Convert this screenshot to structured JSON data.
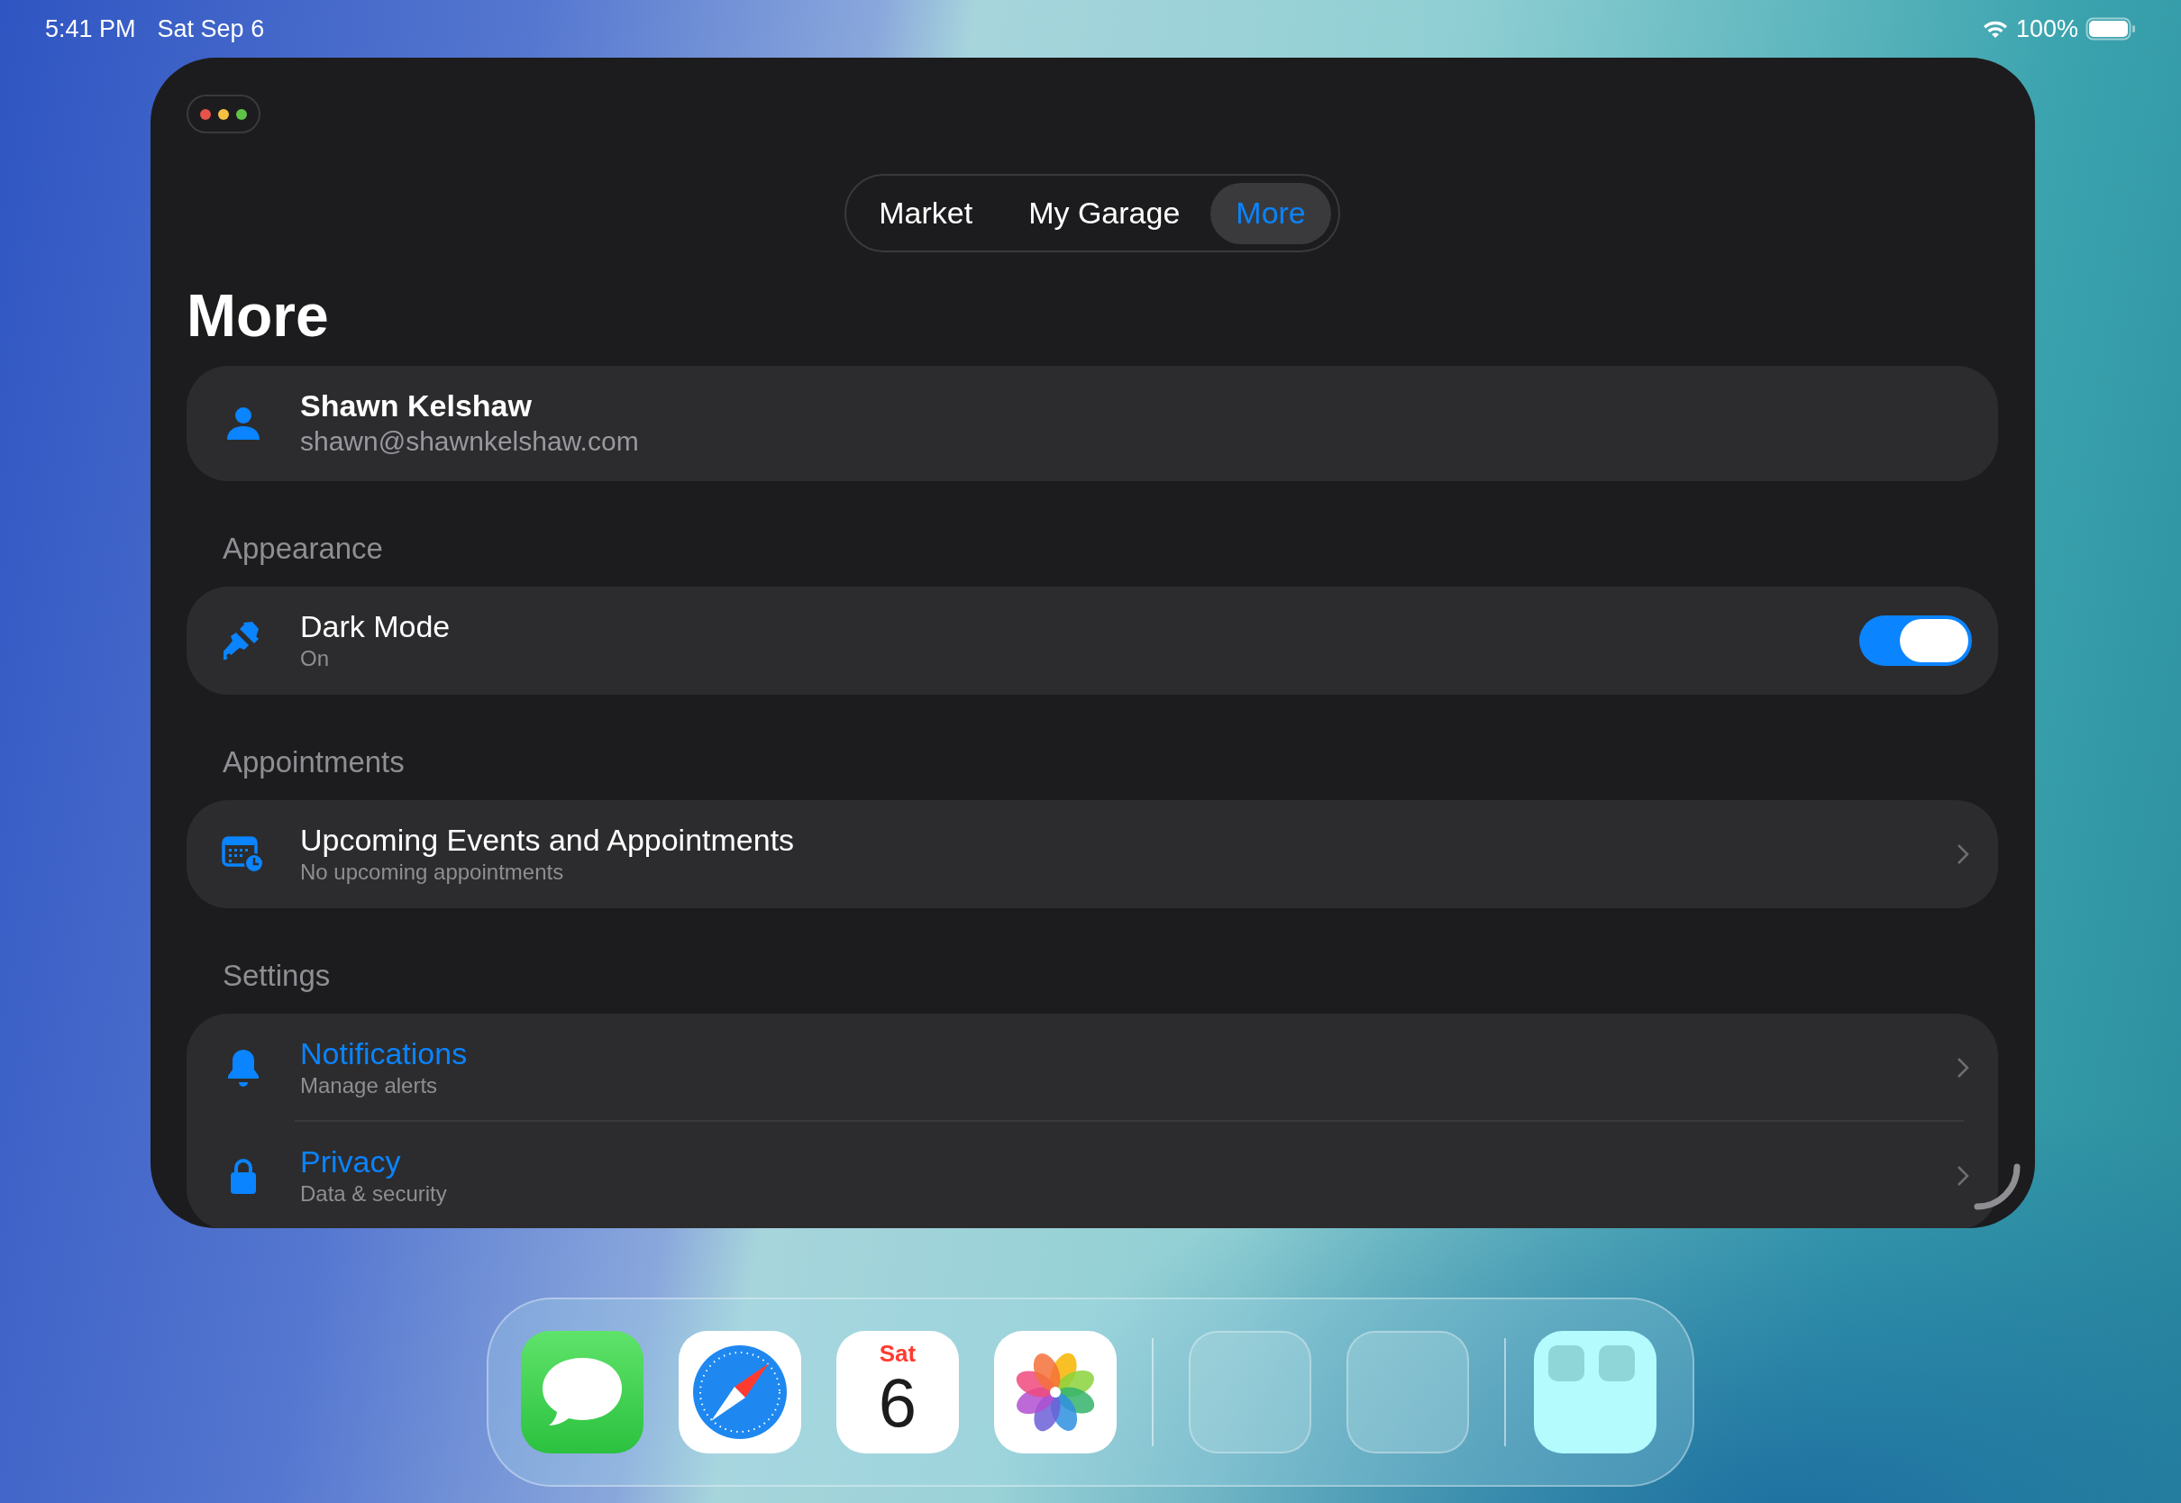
{
  "status_bar": {
    "time": "5:41 PM",
    "date": "Sat Sep 6",
    "battery": "100%"
  },
  "tabs": [
    {
      "label": "Market",
      "selected": false
    },
    {
      "label": "My Garage",
      "selected": false
    },
    {
      "label": "More",
      "selected": true
    }
  ],
  "title": "More",
  "profile": {
    "name": "Shawn Kelshaw",
    "email": "shawn@shawnkelshaw.com"
  },
  "sections": [
    {
      "header": "Appearance",
      "rows": [
        {
          "kind": "toggle",
          "title": "Dark Mode",
          "subtitle": "On",
          "color": "#ffffff",
          "on": true
        }
      ]
    },
    {
      "header": "Appointments",
      "rows": [
        {
          "kind": "link",
          "title": "Upcoming Events and Appointments",
          "subtitle": "No upcoming appointments",
          "color": "#ffffff"
        }
      ]
    },
    {
      "header": "Settings",
      "rows": [
        {
          "kind": "link",
          "title": "Notifications",
          "subtitle": "Manage alerts",
          "color": "#0a84ff"
        },
        {
          "kind": "link",
          "title": "Privacy",
          "subtitle": "Data & security",
          "color": "#0a84ff"
        }
      ]
    }
  ],
  "dock": {
    "apps": [
      {
        "kind": "messages"
      },
      {
        "kind": "safari"
      },
      {
        "kind": "calendar",
        "day": "Sat",
        "date": "6"
      },
      {
        "kind": "photos"
      },
      {
        "kind": "divider"
      },
      {
        "kind": "empty"
      },
      {
        "kind": "empty"
      },
      {
        "kind": "divider"
      },
      {
        "kind": "folder"
      }
    ]
  }
}
